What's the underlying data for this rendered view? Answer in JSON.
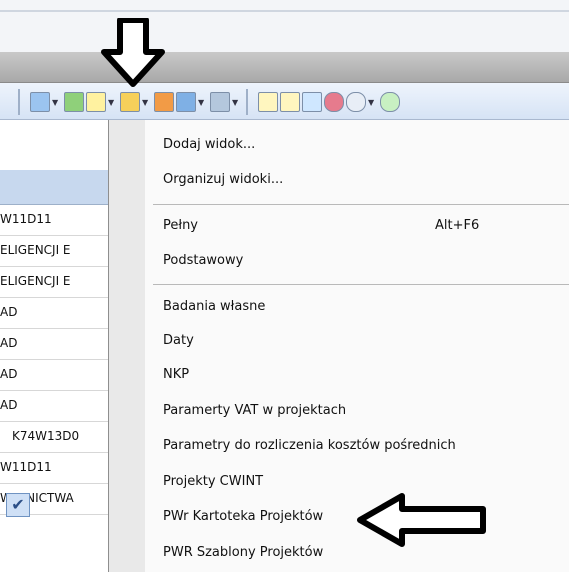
{
  "grid": {
    "rows": [
      "W11D11",
      "ELIGENCJI E",
      "ELIGENCJI E",
      "AD",
      "AD",
      "AD",
      "AD",
      "K74W13D0",
      "W11D11",
      "WALNICTWA"
    ]
  },
  "menu": {
    "group1": [
      "Dodaj widok...",
      "Organizuj widoki..."
    ],
    "group2": [
      {
        "label": "Pełny",
        "shortcut": "Alt+F6"
      },
      {
        "label": "Podstawowy",
        "shortcut": ""
      }
    ],
    "group3": [
      "Badania własne",
      "Daty",
      "NKP",
      "Paramerty VAT w projektach",
      "Parametry do rozliczenia kosztów pośrednich",
      "Projekty CWINT",
      "PWr Kartoteka Projektów",
      "PWR Szablony Projektów"
    ],
    "checked_item": "PWr Kartoteka Projektów"
  },
  "icons": [
    "columns-icon",
    "save-view-icon",
    "views-icon",
    "filter-icon",
    "edit-icon",
    "chart-icon",
    "tools-icon",
    "new-row-icon",
    "list-icon",
    "copy-icon",
    "record-icon",
    "refresh-icon"
  ],
  "colors": {
    "menu_bg": "#fafafa",
    "gutter": "#e9e9e9",
    "toolbar": "#d6e3f5",
    "check_highlight": "#cfe0f6"
  }
}
